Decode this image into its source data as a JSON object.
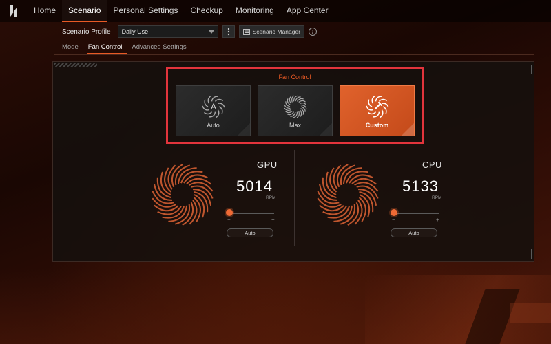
{
  "nav": {
    "items": [
      {
        "label": "Home",
        "active": false
      },
      {
        "label": "Scenario",
        "active": true
      },
      {
        "label": "Personal Settings",
        "active": false
      },
      {
        "label": "Checkup",
        "active": false
      },
      {
        "label": "Monitoring",
        "active": false
      },
      {
        "label": "App Center",
        "active": false
      }
    ]
  },
  "profile": {
    "label": "Scenario Profile",
    "selected": "Daily Use",
    "more_icon": "more-vertical-icon",
    "manager_label": "Scenario Manager",
    "info_icon": "info-icon"
  },
  "subtabs": [
    {
      "label": "Mode",
      "active": false
    },
    {
      "label": "Fan Control",
      "active": true
    },
    {
      "label": "Advanced Settings",
      "active": false
    }
  ],
  "fan_control": {
    "title": "Fan Control",
    "modes": [
      {
        "label": "Auto",
        "icon": "fan-auto-icon",
        "active": false
      },
      {
        "label": "Max",
        "icon": "fan-max-icon",
        "active": false
      },
      {
        "label": "Custom",
        "icon": "fan-custom-icon",
        "active": true
      }
    ]
  },
  "fans": {
    "gpu": {
      "name": "GPU",
      "rpm": "5014",
      "unit": "RPM",
      "minus": "−",
      "plus": "+",
      "auto_label": "Auto",
      "level": 0.05
    },
    "cpu": {
      "name": "CPU",
      "rpm": "5133",
      "unit": "RPM",
      "minus": "−",
      "plus": "+",
      "auto_label": "Auto",
      "level": 0.05
    }
  },
  "colors": {
    "accent": "#e85a25",
    "highlight_border": "#e2343c"
  }
}
